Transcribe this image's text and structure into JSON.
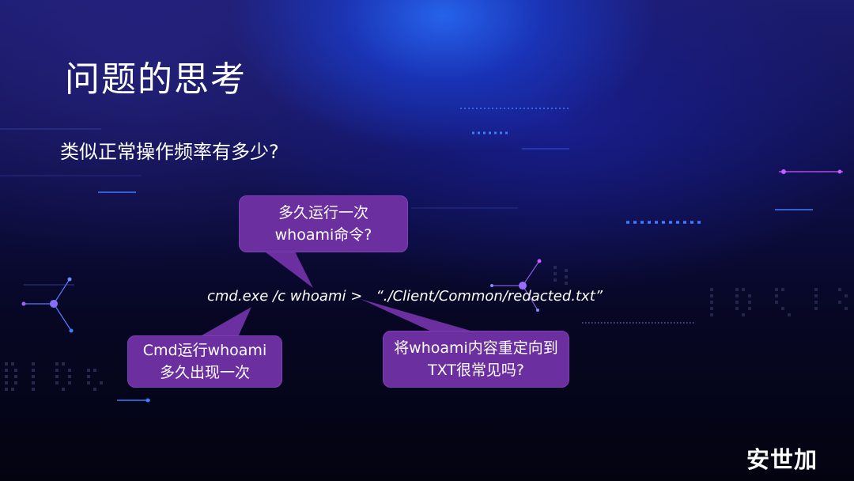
{
  "slide": {
    "title": "问题的思考",
    "subtitle": "类似正常操作频率有多少?",
    "command": "cmd.exe /c whoami >   “./Client/Common/redacted.txt”",
    "callouts": [
      {
        "line1": "多久运行一次",
        "line2": "whoami命令?"
      },
      {
        "line1": "Cmd运行whoami",
        "line2": "多久出现一次"
      },
      {
        "line1": "将whoami内容重定向到",
        "line2": "TXT很常见吗?"
      }
    ],
    "logo": "安世加"
  },
  "colors": {
    "callout_fill": "#6b2fa0",
    "background_dark": "#05051e",
    "accent_blue": "#2a6bff",
    "accent_purple": "#b04ce0"
  }
}
